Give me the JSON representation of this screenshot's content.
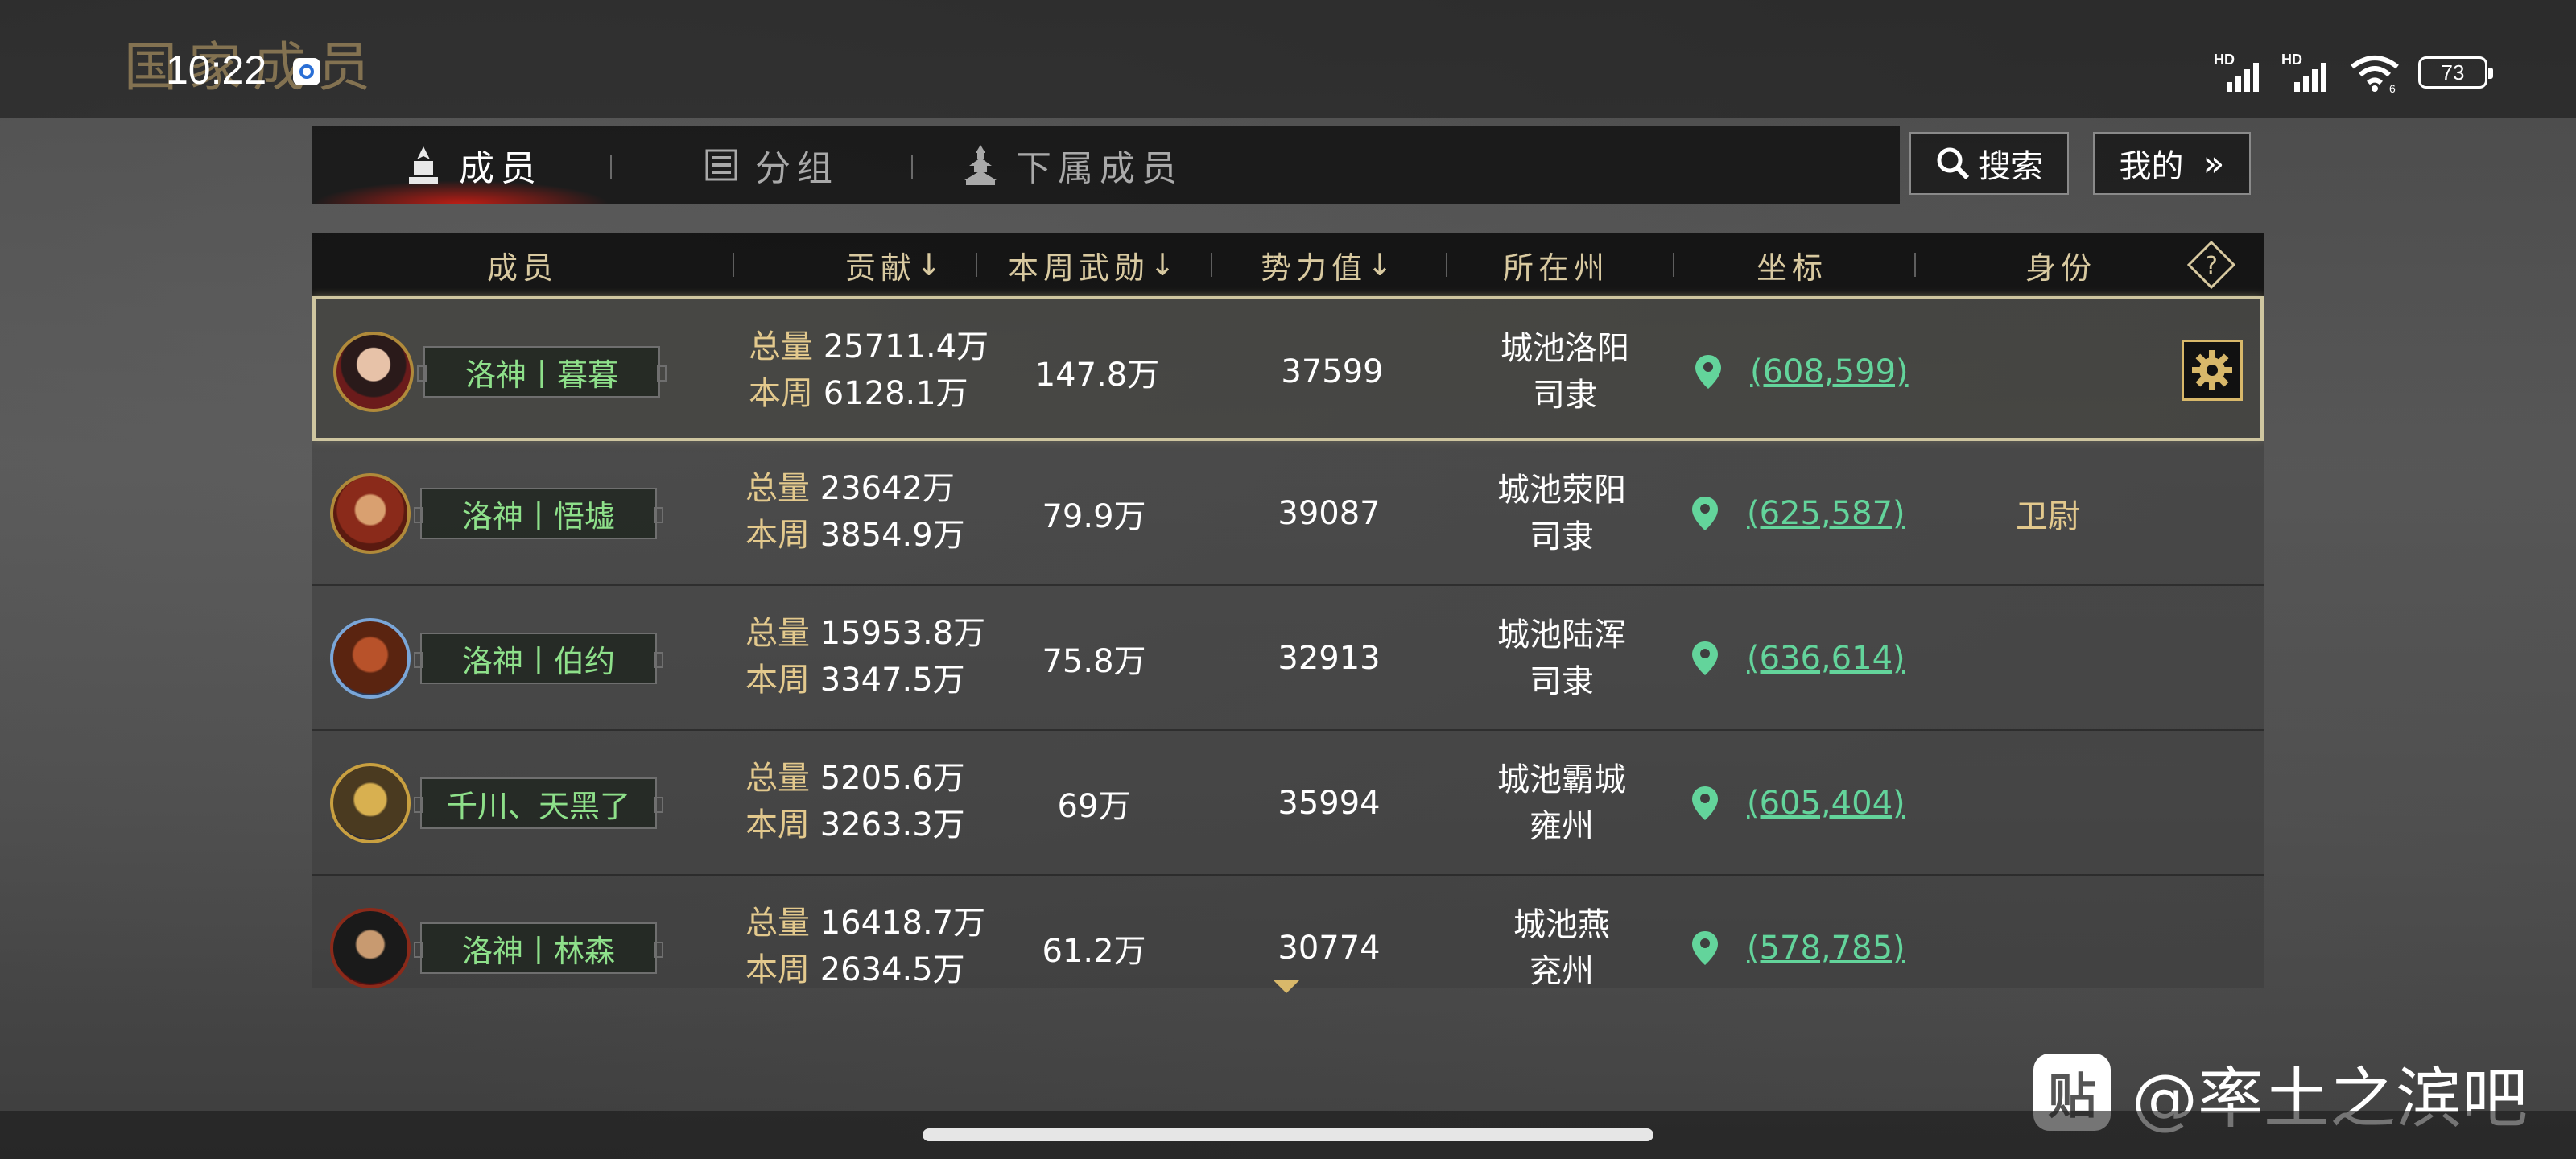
{
  "status_bar": {
    "time": "10:22",
    "signal_1": "HD",
    "signal_2": "HD",
    "wifi_badge": "6",
    "battery": "73"
  },
  "page": {
    "title": "国家成员"
  },
  "tabs": [
    {
      "label": "成员",
      "active": true,
      "icon": "member-icon"
    },
    {
      "label": "分组",
      "active": false,
      "icon": "list-icon"
    },
    {
      "label": "下属成员",
      "active": false,
      "icon": "pagoda-icon"
    }
  ],
  "toolbar": {
    "search_label": "搜索",
    "mine_label": "我的",
    "mine_arrow": "»"
  },
  "table": {
    "headers": {
      "member": "成员",
      "contribution": "贡献",
      "contribution_sort": "↓",
      "weekly_merit": "本周武勋",
      "weekly_merit_sort": "↓",
      "power": "势力值",
      "power_sort": "↓",
      "region": "所在州",
      "coordinates": "坐标",
      "role": "身份",
      "help": "?"
    },
    "labels": {
      "total": "总量",
      "week": "本周"
    },
    "rows": [
      {
        "name": "洛神丨暮暮",
        "total": "25711.4万",
        "week": "6128.1万",
        "merit": "147.8万",
        "power": "37599",
        "city": "城池洛阳",
        "province": "司隶",
        "coord": "(608,599)",
        "role": "",
        "selected": true
      },
      {
        "name": "洛神丨悟墟",
        "total": "23642万",
        "week": "3854.9万",
        "merit": "79.9万",
        "power": "39087",
        "city": "城池荥阳",
        "province": "司隶",
        "coord": "(625,587)",
        "role": "卫尉",
        "selected": false
      },
      {
        "name": "洛神丨伯约",
        "total": "15953.8万",
        "week": "3347.5万",
        "merit": "75.8万",
        "power": "32913",
        "city": "城池陆浑",
        "province": "司隶",
        "coord": "(636,614)",
        "role": "",
        "selected": false
      },
      {
        "name": "千川、天黑了",
        "total": "5205.6万",
        "week": "3263.3万",
        "merit": "69万",
        "power": "35994",
        "city": "城池霸城",
        "province": "雍州",
        "coord": "(605,404)",
        "role": "",
        "selected": false
      },
      {
        "name": "洛神丨林森",
        "total": "16418.7万",
        "week": "2634.5万",
        "merit": "61.2万",
        "power": "30774",
        "city": "城池燕",
        "province": "兖州",
        "coord": "(578,785)",
        "role": "",
        "selected": false
      }
    ]
  },
  "watermark": {
    "logo_text": "贴",
    "text": "@率土之滨吧"
  },
  "colors": {
    "name_green": "#8ee08a",
    "coord_green": "#63d49b",
    "gold": "#e3c98d",
    "header_gold": "#d8c9a0",
    "tab_glow_red": "#dc1e14"
  }
}
